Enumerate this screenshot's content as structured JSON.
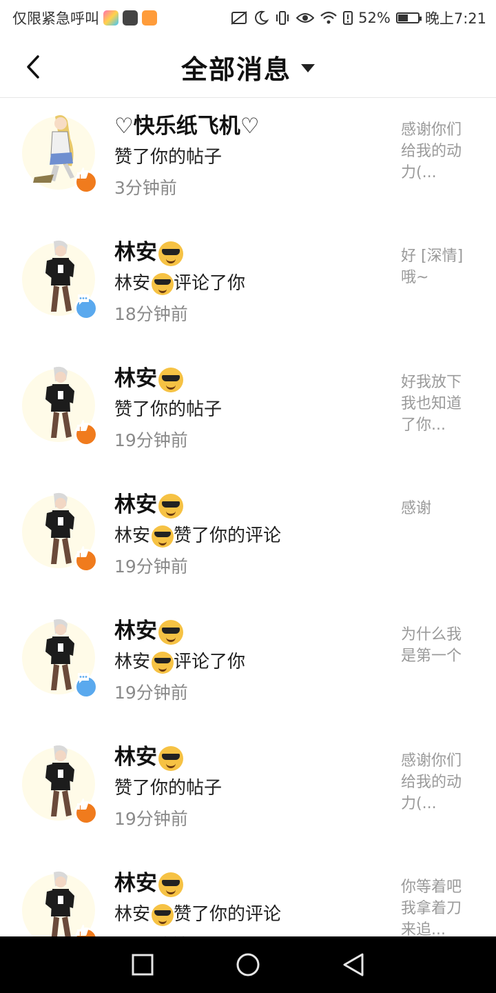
{
  "status_bar": {
    "carrier_text": "仅限紧急呼叫",
    "battery_percent": "52%",
    "battery_level": 0.52,
    "time": "晚上7:21",
    "icons": [
      "gallery-app-icon",
      "huawei-app-icon",
      "video-app-icon",
      "no-sim-icon",
      "moon-icon",
      "vibrate-icon",
      "eye-icon",
      "wifi-icon",
      "alert-battery-icon"
    ]
  },
  "header": {
    "back_icon": "chevron-left-icon",
    "title": "全部消息",
    "dropdown_icon": "caret-down-icon"
  },
  "colors": {
    "like_badge": "#f07b1d",
    "comment_badge": "#5aa9ee",
    "time_text": "#8a8a8a",
    "snippet_text": "#9a9a9a"
  },
  "messages": [
    {
      "name": "♡快乐纸飞机♡",
      "has_emoji": false,
      "action_prefix": "",
      "action": "赞了你的帖子",
      "time": "3分钟前",
      "snippet": "感谢你们给我的动力(...",
      "badge": "like",
      "avatar": "girl-avatar"
    },
    {
      "name": "林安",
      "has_emoji": true,
      "action_prefix": "林安",
      "action": "评论了你",
      "time": "18分钟前",
      "snippet": "好 [深情] 哦~",
      "badge": "comment",
      "avatar": "boy-avatar"
    },
    {
      "name": "林安",
      "has_emoji": true,
      "action_prefix": "",
      "action": "赞了你的帖子",
      "time": "19分钟前",
      "snippet": "好我放下我也知道了你...",
      "badge": "like",
      "avatar": "boy-avatar"
    },
    {
      "name": "林安",
      "has_emoji": true,
      "action_prefix": "林安",
      "action": "赞了你的评论",
      "time": "19分钟前",
      "snippet": "感谢",
      "badge": "like",
      "avatar": "boy-avatar"
    },
    {
      "name": "林安",
      "has_emoji": true,
      "action_prefix": "林安",
      "action": "评论了你",
      "time": "19分钟前",
      "snippet": "为什么我是第一个",
      "badge": "comment",
      "avatar": "boy-avatar"
    },
    {
      "name": "林安",
      "has_emoji": true,
      "action_prefix": "",
      "action": "赞了你的帖子",
      "time": "19分钟前",
      "snippet": "感谢你们给我的动力(...",
      "badge": "like",
      "avatar": "boy-avatar"
    },
    {
      "name": "林安",
      "has_emoji": true,
      "action_prefix": "林安",
      "action": "赞了你的评论",
      "time": "19分钟前",
      "snippet": "你等着吧我拿着刀来追...",
      "badge": "like",
      "avatar": "boy-avatar"
    }
  ],
  "nav_bar": {
    "icons": [
      "recent-apps-icon",
      "home-icon",
      "back-triangle-icon"
    ]
  }
}
